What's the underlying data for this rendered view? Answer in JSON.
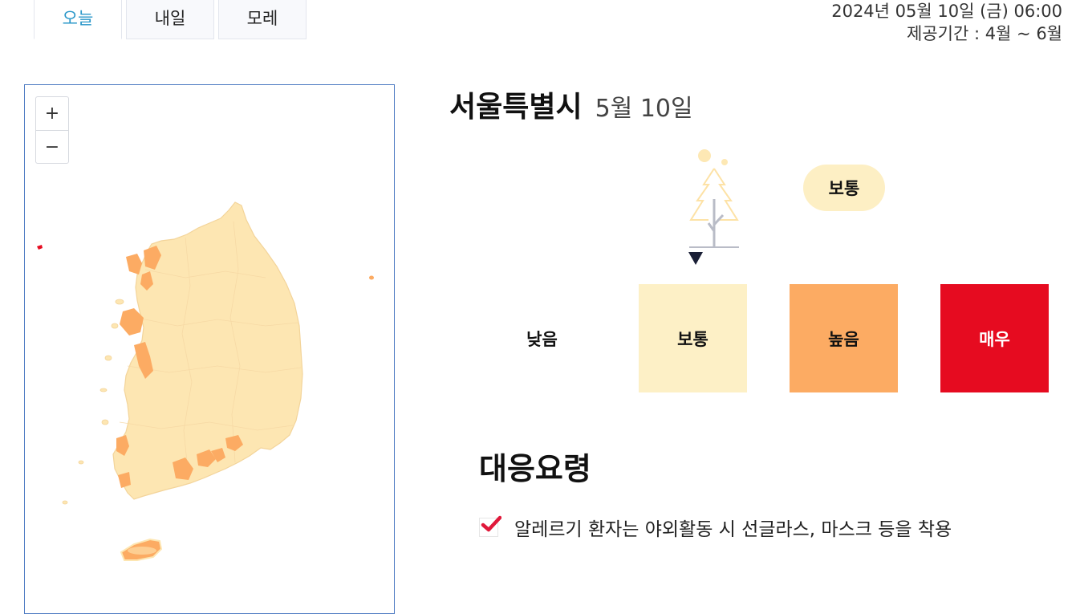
{
  "tabs": [
    {
      "label": "오늘",
      "active": true
    },
    {
      "label": "내일",
      "active": false
    },
    {
      "label": "모레",
      "active": false
    }
  ],
  "info": {
    "timestamp": "2024년 05월 10일 (금) 06:00",
    "period": "제공기간 : 4월 ~ 6월"
  },
  "map": {
    "zoom_in": "+",
    "zoom_out": "−",
    "colors": {
      "land": "#fde6b2",
      "border": "#f7d9a0",
      "high": "#fcab63",
      "very_high": "#e60b20"
    }
  },
  "region": {
    "name": "서울특별시",
    "date": "5월 10일"
  },
  "current_level": {
    "label": "보통",
    "pill_color": "#fdefc4",
    "icon": "tree-icon"
  },
  "levels": [
    {
      "label": "낮음",
      "bg": "#ffffff",
      "text_color": "#111111"
    },
    {
      "label": "보통",
      "bg": "#fdf0c6",
      "text_color": "#111111"
    },
    {
      "label": "높음",
      "bg": "#fcab63",
      "text_color": "#111111"
    },
    {
      "label": "매우",
      "bg": "#e60b20",
      "text_color": "#ffffff"
    }
  ],
  "response": {
    "title": "대응요령",
    "items": [
      {
        "text": "알레르기 환자는 야외활동 시 선글라스, 마스크 등을 착용",
        "icon": "check-icon",
        "checked": true
      }
    ]
  }
}
